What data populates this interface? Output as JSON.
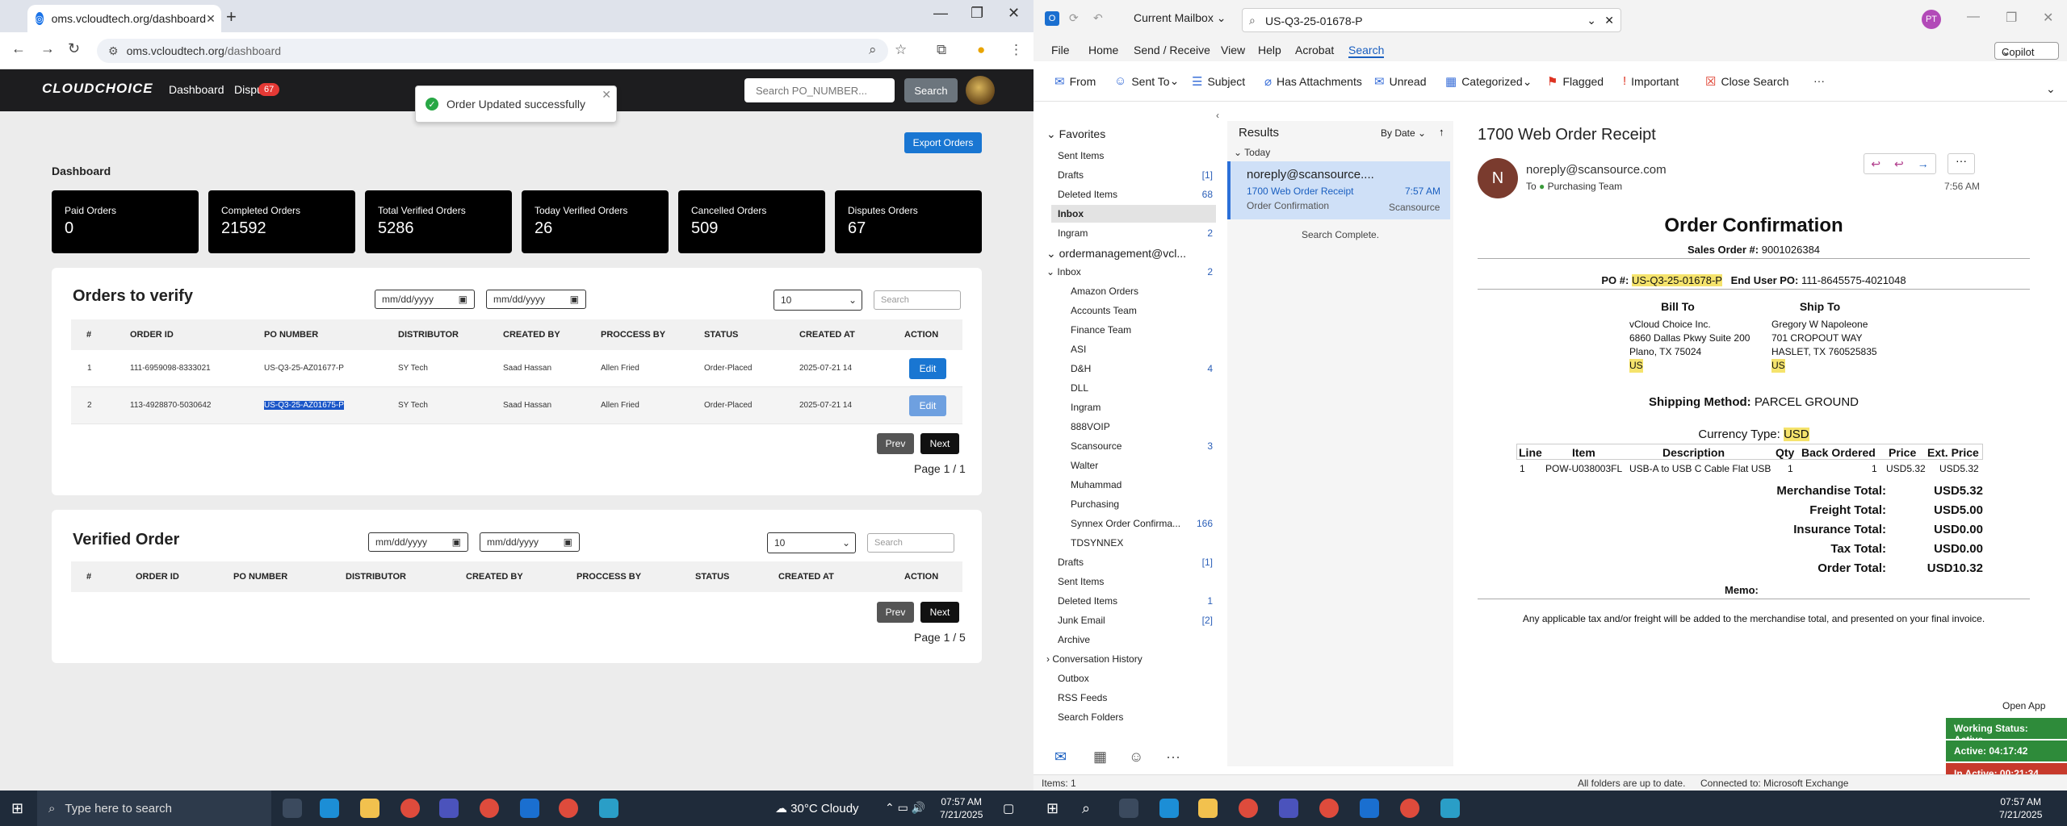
{
  "browser": {
    "tab_title": "oms.vcloudtech.org/dashboard",
    "url_host": "oms.vcloudtech.org",
    "url_path": "/dashboard"
  },
  "app": {
    "logo": "CLOUDCHOICE",
    "nav": {
      "dashboard": "Dashboard",
      "disputes": "Dispu",
      "disputes_badge": "67"
    },
    "po_search_placeholder": "Search PO_NUMBER...",
    "search_btn": "Search",
    "toast": "Order Updated successfully",
    "export_btn": "Export Orders",
    "dash_title": "Dashboard",
    "stats": [
      {
        "label": "Paid Orders",
        "value": "0"
      },
      {
        "label": "Completed Orders",
        "value": "21592"
      },
      {
        "label": "Total Verified Orders",
        "value": "5286"
      },
      {
        "label": "Today Verified Orders",
        "value": "26"
      },
      {
        "label": "Cancelled Orders",
        "value": "509"
      },
      {
        "label": "Disputes Orders",
        "value": "67"
      }
    ],
    "date_placeholder": "mm/dd/yyyy",
    "page_size": "10",
    "search_placeholder": "Search",
    "columns": [
      "#",
      "ORDER ID",
      "PO NUMBER",
      "DISTRIBUTOR",
      "CREATED BY",
      "PROCCESS BY",
      "STATUS",
      "CREATED AT",
      "ACTION"
    ],
    "verify": {
      "title": "Orders to verify",
      "rows": [
        {
          "n": "1",
          "order_id": "111-6959098-8333021",
          "po": "US-Q3-25-AZ01677-P",
          "dist": "SY Tech",
          "created_by": "Saad Hassan",
          "process_by": "Allen Fried",
          "status": "Order-Placed",
          "created_at": "2025-07-21 14",
          "action": "Edit"
        },
        {
          "n": "2",
          "order_id": "113-4928870-5030642",
          "po": "US-Q3-25-AZ01675-P",
          "dist": "SY Tech",
          "created_by": "Saad Hassan",
          "process_by": "Allen Fried",
          "status": "Order-Placed",
          "created_at": "2025-07-21 14",
          "action": "Edit"
        }
      ],
      "prev": "Prev",
      "next": "Next",
      "page": "Page 1 / 1"
    },
    "verified": {
      "title": "Verified Order",
      "prev": "Prev",
      "next": "Next",
      "page": "Page 1 / 5"
    }
  },
  "outlook": {
    "mailbox": "Current Mailbox",
    "search_value": "US-Q3-25-01678-P",
    "profile": "PT",
    "copilot": "Copilot",
    "menu": [
      "File",
      "Home",
      "Send / Receive",
      "View",
      "Help",
      "Acrobat",
      "Search"
    ],
    "ribbon": [
      "From",
      "Sent To",
      "Subject",
      "Has Attachments",
      "Unread",
      "Categorized",
      "Flagged",
      "Important",
      "Close Search"
    ],
    "favorites_label": "Favorites",
    "favorites": [
      {
        "name": "Sent Items",
        "count": ""
      },
      {
        "name": "Drafts",
        "count": "[1]"
      },
      {
        "name": "Deleted Items",
        "count": "68"
      },
      {
        "name": "Inbox",
        "count": ""
      },
      {
        "name": "Ingram",
        "count": "2"
      }
    ],
    "account": "ordermanagement@vcl...",
    "inbox": {
      "name": "Inbox",
      "count": "2"
    },
    "subfolders": [
      {
        "name": "Amazon Orders",
        "count": ""
      },
      {
        "name": "Accounts Team",
        "count": ""
      },
      {
        "name": "Finance Team",
        "count": ""
      },
      {
        "name": "ASI",
        "count": ""
      },
      {
        "name": "D&H",
        "count": "4"
      },
      {
        "name": "DLL",
        "count": ""
      },
      {
        "name": "Ingram",
        "count": ""
      },
      {
        "name": "888VOIP",
        "count": ""
      },
      {
        "name": "Scansource",
        "count": "3"
      },
      {
        "name": "Walter",
        "count": ""
      },
      {
        "name": "Muhammad",
        "count": ""
      },
      {
        "name": "Purchasing",
        "count": ""
      },
      {
        "name": "Synnex Order Confirma...",
        "count": "166"
      },
      {
        "name": "TDSYNNEX",
        "count": ""
      }
    ],
    "rootfolders": [
      {
        "name": "Drafts",
        "count": "[1]"
      },
      {
        "name": "Sent Items",
        "count": ""
      },
      {
        "name": "Deleted Items",
        "count": "1"
      },
      {
        "name": "Junk Email",
        "count": "[2]"
      },
      {
        "name": "Archive",
        "count": ""
      },
      {
        "name": "Conversation History",
        "count": ""
      },
      {
        "name": "Outbox",
        "count": ""
      },
      {
        "name": "RSS Feeds",
        "count": ""
      },
      {
        "name": "Search Folders",
        "count": ""
      }
    ],
    "results": {
      "title": "Results",
      "sort": "By Date",
      "group": "Today",
      "from": "noreply@scansource....",
      "subject": "1700 Web Order Receipt",
      "time": "7:57 AM",
      "preview": "Order Confirmation",
      "folder": "Scansource",
      "complete": "Search Complete."
    },
    "message": {
      "subject": "1700 Web Order Receipt",
      "avatar": "N",
      "from": "noreply@scansource.com",
      "to_label": "To",
      "to": "Purchasing Team",
      "time": "7:56 AM"
    },
    "invoice": {
      "title": "Order Confirmation",
      "sales_order_label": "Sales Order #:",
      "sales_order": "9001026384",
      "po_label": "PO #:",
      "po": "US-Q3-25-01678-P",
      "enduser_label": "End User PO:",
      "enduser": "111-8645575-4021048",
      "bill_to_label": "Bill To",
      "ship_to_label": "Ship To",
      "bill_to": [
        "vCloud Choice Inc.",
        "6860 Dallas Pkwy Suite 200",
        "Plano, TX 75024",
        "US"
      ],
      "ship_to": [
        "Gregory W Napoleone",
        "701 CROPOUT WAY",
        "HASLET, TX 760525835",
        "US"
      ],
      "ship_method_label": "Shipping Method:",
      "ship_method": "PARCEL GROUND",
      "currency_label": "Currency Type:",
      "currency": "USD",
      "cols": [
        "Line",
        "Item",
        "Description",
        "Qty",
        "Back Ordered",
        "Price",
        "Ext. Price"
      ],
      "line": {
        "line": "1",
        "item": "POW-U038003FL",
        "desc": "USB-A to USB C Cable Flat USB",
        "qty": "1",
        "back": "1",
        "price": "USD5.32",
        "ext": "USD5.32"
      },
      "totals": [
        {
          "label": "Merchandise Total:",
          "value": "USD5.32"
        },
        {
          "label": "Freight Total:",
          "value": "USD5.00"
        },
        {
          "label": "Insurance Total:",
          "value": "USD0.00"
        },
        {
          "label": "Tax Total:",
          "value": "USD0.00"
        },
        {
          "label": "Order Total:",
          "value": "USD10.32"
        }
      ],
      "memo_label": "Memo:",
      "footer": "Any applicable tax and/or freight will be added to the merchandise total, and presented on your final invoice."
    },
    "status": {
      "items": "Items: 1",
      "uptodate": "All folders are up to date.",
      "connected": "Connected to: Microsoft Exchange"
    },
    "widget": {
      "open": "Open App",
      "working": "Working Status: Active",
      "active": "Active: 04:17:42",
      "inactive": "In Active: 00:21:34"
    }
  },
  "taskbar": {
    "search": "Type here to search",
    "weather": "30°C Cloudy",
    "time": "07:57 AM",
    "date": "7/21/2025",
    "time2": "07:57 AM",
    "date2": "7/21/2025"
  }
}
